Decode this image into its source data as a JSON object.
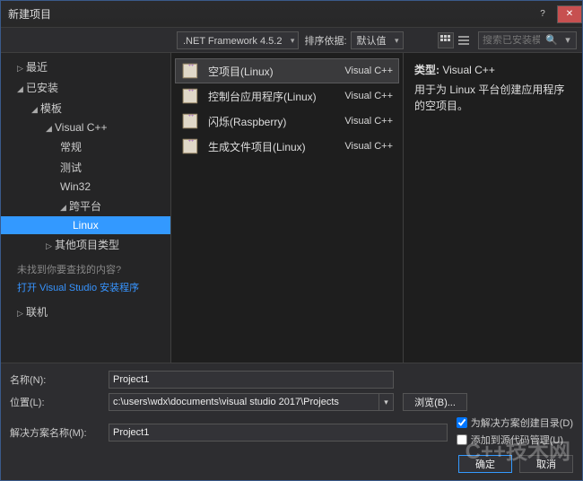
{
  "title": "新建项目",
  "toolbar": {
    "framework": ".NET Framework 4.5.2",
    "sort_label": "排序依据:",
    "sort_value": "默认值",
    "search_placeholder": "搜索已安装模"
  },
  "sidebar": {
    "recent": "最近",
    "installed": "已安装",
    "templates": "模板",
    "vcpp": "Visual C++",
    "general": "常规",
    "test": "测试",
    "win32": "Win32",
    "cross": "跨平台",
    "linux": "Linux",
    "other": "其他项目类型",
    "prompt": "未找到你要查找的内容?",
    "link": "打开 Visual Studio 安装程序",
    "online": "联机"
  },
  "templates": [
    {
      "name": "空项目(Linux)",
      "lang": "Visual C++"
    },
    {
      "name": "控制台应用程序(Linux)",
      "lang": "Visual C++"
    },
    {
      "name": "闪烁(Raspberry)",
      "lang": "Visual C++"
    },
    {
      "name": "生成文件项目(Linux)",
      "lang": "Visual C++"
    }
  ],
  "desc": {
    "type_label": "类型:",
    "type_value": "Visual C++",
    "text": "用于为 Linux 平台创建应用程序的空项目。"
  },
  "bottom": {
    "name_label": "名称(N):",
    "name_value": "Project1",
    "loc_label": "位置(L):",
    "loc_value": "c:\\users\\wdx\\documents\\visual studio 2017\\Projects",
    "sol_label": "解决方案名称(M):",
    "sol_value": "Project1",
    "browse": "浏览(B)...",
    "chk_dir": "为解决方案创建目录(D)",
    "chk_src": "添加到源代码管理(U)",
    "ok": "确定",
    "cancel": "取消"
  },
  "watermark": "C++技术网"
}
